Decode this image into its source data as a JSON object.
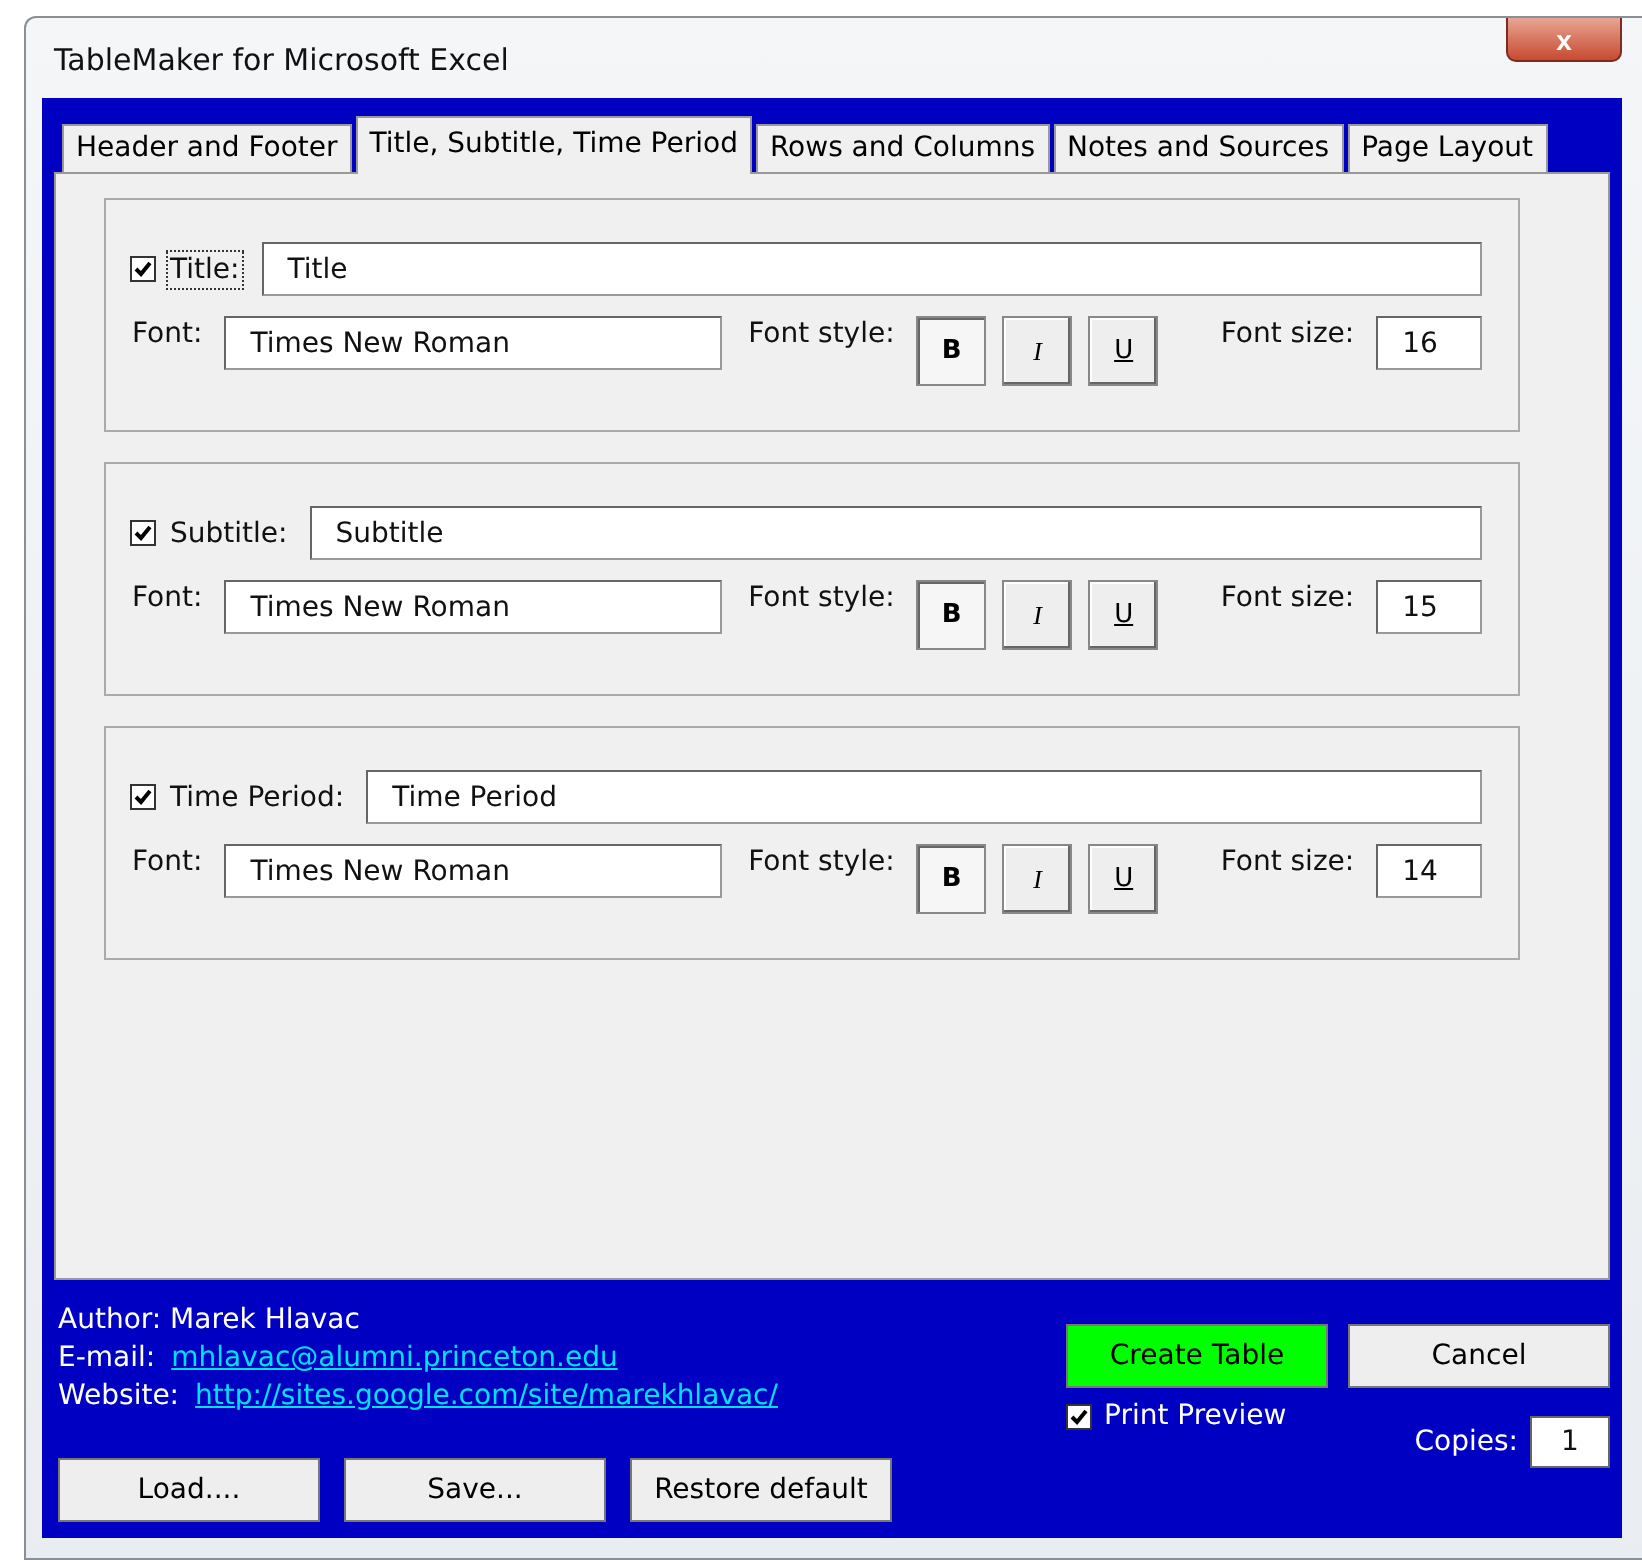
{
  "window": {
    "title": "TableMaker for Microsoft Excel",
    "close": "x"
  },
  "tabs": [
    {
      "label": "Header and Footer",
      "selected": false
    },
    {
      "label": "Title, Subtitle, Time Period",
      "selected": true
    },
    {
      "label": "Rows and Columns",
      "selected": false
    },
    {
      "label": "Notes and Sources",
      "selected": false
    },
    {
      "label": "Page Layout",
      "selected": false
    }
  ],
  "sections": [
    {
      "label": "Title:",
      "checked": true,
      "focused": true,
      "value": "Title",
      "font_label": "Font:",
      "font": "Times New Roman",
      "style_label": "Font style:",
      "bold": "B",
      "bold_on": true,
      "italic": "I",
      "italic_on": false,
      "underline": "U",
      "underline_on": false,
      "size_label": "Font size:",
      "size": "16"
    },
    {
      "label": "Subtitle:",
      "checked": true,
      "focused": false,
      "value": "Subtitle",
      "font_label": "Font:",
      "font": "Times New Roman",
      "style_label": "Font style:",
      "bold": "B",
      "bold_on": true,
      "italic": "I",
      "italic_on": false,
      "underline": "U",
      "underline_on": false,
      "size_label": "Font size:",
      "size": "15"
    },
    {
      "label": "Time Period:",
      "checked": true,
      "focused": false,
      "value": "Time Period",
      "font_label": "Font:",
      "font": "Times New Roman",
      "style_label": "Font style:",
      "bold": "B",
      "bold_on": true,
      "italic": "I",
      "italic_on": false,
      "underline": "U",
      "underline_on": false,
      "size_label": "Font size:",
      "size": "14"
    }
  ],
  "footer": {
    "author": "Author: Marek Hlavac",
    "email_label": "E-mail:",
    "email": "mhlavac@alumni.princeton.edu",
    "website_label": "Website:",
    "website": "http://sites.google.com/site/marekhlavac/",
    "create": "Create Table",
    "cancel": "Cancel",
    "print_preview": {
      "label": "Print Preview",
      "checked": true
    },
    "copies_label": "Copies:",
    "copies": "1",
    "buttons": [
      "Load....",
      "Save...",
      "Restore default"
    ]
  }
}
